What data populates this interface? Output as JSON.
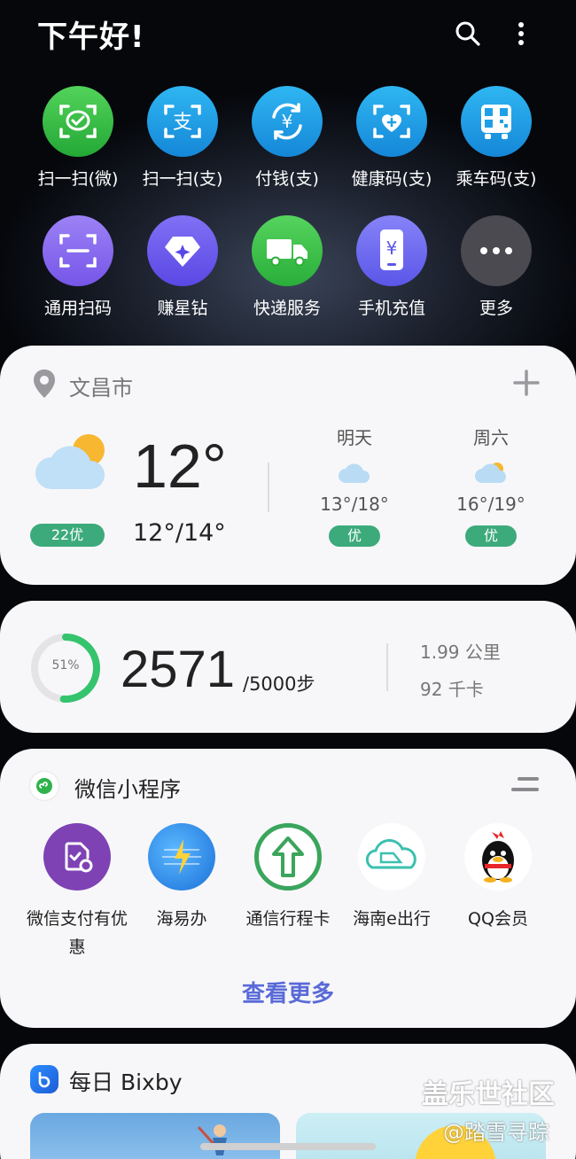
{
  "header": {
    "greeting": "下午好!",
    "search_icon": "search-icon",
    "more_icon": "more-vertical-icon"
  },
  "shortcuts": [
    {
      "label": "扫一扫(微)",
      "icon": "wechat-scan-icon",
      "color": "#36c046"
    },
    {
      "label": "扫一扫(支)",
      "icon": "alipay-scan-icon",
      "color": "#1ea0e6"
    },
    {
      "label": "付钱(支)",
      "icon": "yuan-pay-icon",
      "color": "#1ea0e6"
    },
    {
      "label": "健康码(支)",
      "icon": "health-code-icon",
      "color": "#1ea0e6"
    },
    {
      "label": "乘车码(支)",
      "icon": "bus-code-icon",
      "color": "#1ea0e6"
    },
    {
      "label": "通用扫码",
      "icon": "generic-scan-icon",
      "color": "#8a6df0"
    },
    {
      "label": "赚星钻",
      "icon": "star-diamond-icon",
      "color": "#6f5cf0"
    },
    {
      "label": "快递服务",
      "icon": "delivery-truck-icon",
      "color": "#3ec24e"
    },
    {
      "label": "手机充值",
      "icon": "phone-recharge-icon",
      "color": "#6f68f2"
    },
    {
      "label": "更多",
      "icon": "more-dots-icon",
      "color": "#4a4a4f"
    }
  ],
  "weather": {
    "city": "文昌市",
    "temp": "12°",
    "range": "12°/14°",
    "aqi": "22优",
    "forecast": [
      {
        "day": "明天",
        "range": "13°/18°",
        "aqi": "优"
      },
      {
        "day": "周六",
        "range": "16°/19°",
        "aqi": "优"
      }
    ]
  },
  "steps": {
    "percent_label": "51%",
    "percent": 51,
    "count": "2571",
    "goal": "/5000步",
    "distance": "1.99 公里",
    "calories": "92 千卡"
  },
  "mini_programs": {
    "title": "微信小程序",
    "items": [
      {
        "label": "微信支付有优惠",
        "icon": "wechat-pay-coupon-icon"
      },
      {
        "label": "海易办",
        "icon": "haiyiban-icon"
      },
      {
        "label": "通信行程卡",
        "icon": "travel-card-arrow-icon"
      },
      {
        "label": "海南e出行",
        "icon": "hainan-travel-train-icon"
      },
      {
        "label": "QQ会员",
        "icon": "qq-penguin-icon"
      }
    ],
    "see_more": "查看更多"
  },
  "bixby": {
    "title": "每日 Bixby"
  },
  "watermark": {
    "line1": "盖乐世社区",
    "line2": "@踏雪寻踪"
  }
}
